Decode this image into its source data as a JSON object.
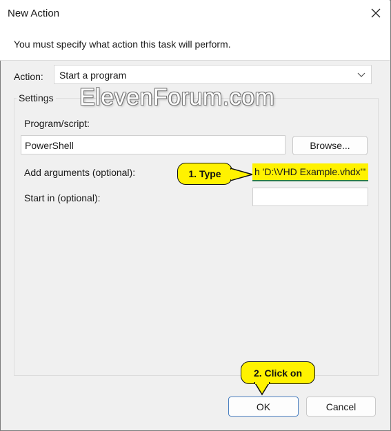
{
  "window": {
    "title": "New Action"
  },
  "banner": {
    "text": "You must specify what action this task will perform."
  },
  "action": {
    "label": "Action:",
    "value": "Start a program"
  },
  "settings": {
    "legend": "Settings",
    "program_label": "Program/script:",
    "program_value": "PowerShell",
    "browse_label": "Browse...",
    "args_label": "Add arguments (optional):",
    "args_value": "h 'D:\\VHD Example.vhdx'\"",
    "startin_label": "Start in (optional):",
    "startin_value": ""
  },
  "annotations": {
    "callout_1": "1. Type",
    "callout_2": "2. Click on"
  },
  "watermark": "ElevenForum.com",
  "footer": {
    "ok_label": "OK",
    "cancel_label": "Cancel"
  },
  "colors": {
    "callout": "#fff200",
    "dialog_bg": "#f0f0f0",
    "primary_border": "#4a7fc0"
  }
}
